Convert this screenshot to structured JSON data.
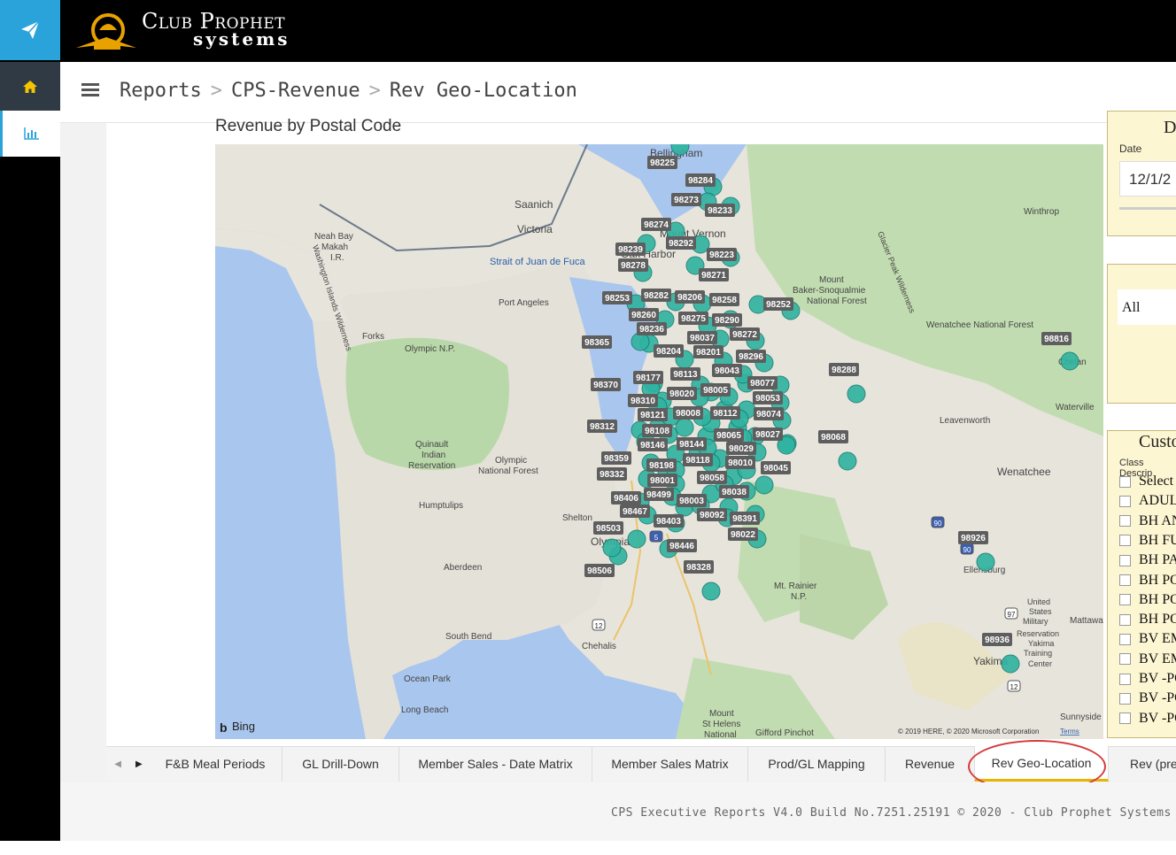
{
  "app": {
    "logo_line1": "Club Prophet",
    "logo_line2": "systems"
  },
  "breadcrumb": {
    "items": [
      "Reports",
      "CPS-Revenue",
      "Rev Geo-Location"
    ],
    "separator": ">"
  },
  "map": {
    "title": "Revenue by Postal Code",
    "place_labels": [
      "Bellingham",
      "Saanich",
      "Victoria",
      "Winthrop",
      "Neah Bay",
      "Makah",
      "I.R.",
      "Strait of Juan de Fuca",
      "Mount Vernon",
      "Oak Harbor",
      "Port Angeles",
      "Mount Baker-Snoqualmie National Forest",
      "Glacier Peak Wilderness",
      "Washington Islands Wilderness",
      "Forks",
      "Olympic N.P.",
      "Wenatchee National Forest",
      "Chelan",
      "Waterville",
      "Leavenworth",
      "Quinault Indian Reservation",
      "Olympic National Forest",
      "Wenatchee",
      "Humptulips",
      "Shelton",
      "Olympia",
      "Aberdeen",
      "Ellensburg",
      "Mt. Rainier N.P.",
      "United States Military Reservation Yakima Training Center",
      "Mattawa",
      "South Bend",
      "Chehalis",
      "Yakima",
      "Ocean Park",
      "Long Beach",
      "Mount St Helens National",
      "Gifford Pinchot",
      "Sunnyside"
    ],
    "postal_codes": [
      "98225",
      "98284",
      "98273",
      "98233",
      "98274",
      "98292",
      "98239",
      "98223",
      "98278",
      "98271",
      "98253",
      "98282",
      "98206",
      "98258",
      "98252",
      "98260",
      "98275",
      "98290",
      "98236",
      "98037",
      "98272",
      "98365",
      "98204",
      "98201",
      "98296",
      "98288",
      "98816",
      "98043",
      "98177",
      "98113",
      "98077",
      "98370",
      "98005",
      "98020",
      "98053",
      "98310",
      "98121",
      "98008",
      "98112",
      "98074",
      "98312",
      "98108",
      "98065",
      "98027",
      "98068",
      "98146",
      "98144",
      "98029",
      "98118",
      "98359",
      "98010",
      "98045",
      "98198",
      "98332",
      "98001",
      "98058",
      "98038",
      "98406",
      "98499",
      "98003",
      "98467",
      "98092",
      "98403",
      "98391",
      "98503",
      "98022",
      "98926",
      "98446",
      "98506",
      "98328",
      "98936"
    ],
    "attribution": "© 2019 HERE, © 2020 Microsoft Corporation",
    "terms_link": "Terms",
    "bing": "Bing",
    "road_shields": [
      "5",
      "90",
      "90",
      "12",
      "97",
      "12"
    ]
  },
  "filters": {
    "date_heading": "D",
    "date_label": "Date",
    "date_value": "12/1/2",
    "slicer_value": "All",
    "customer_heading": "Custo",
    "class_label": "Class Descrip",
    "options": [
      "Select",
      "ADUL",
      "BH AN",
      "BH FU",
      "BH PA",
      "BH PO",
      "BH PO",
      "BH PO",
      "BV EM",
      "BV EM",
      "BV -PO",
      "BV -PO",
      "BV -PO"
    ]
  },
  "tabs": {
    "items": [
      "F&B Meal Periods",
      "GL Drill-Down",
      "Member Sales - Date Matrix",
      "Member Sales Matrix",
      "Prod/GL Mapping",
      "Revenue",
      "Rev Geo-Location",
      "Rev (pre"
    ],
    "active": "Rev Geo-Location"
  },
  "footer": {
    "text": "CPS Executive Reports V4.0 Build No.7251.25191 © 2020 - Club Prophet Systems"
  },
  "colors": {
    "sidebar_accent": "#2aa3db",
    "home_icon": "#f5c400",
    "marker": "#2fb3a0",
    "highlight_oval": "#d63a3a",
    "active_tab_underline": "#e8b400"
  }
}
